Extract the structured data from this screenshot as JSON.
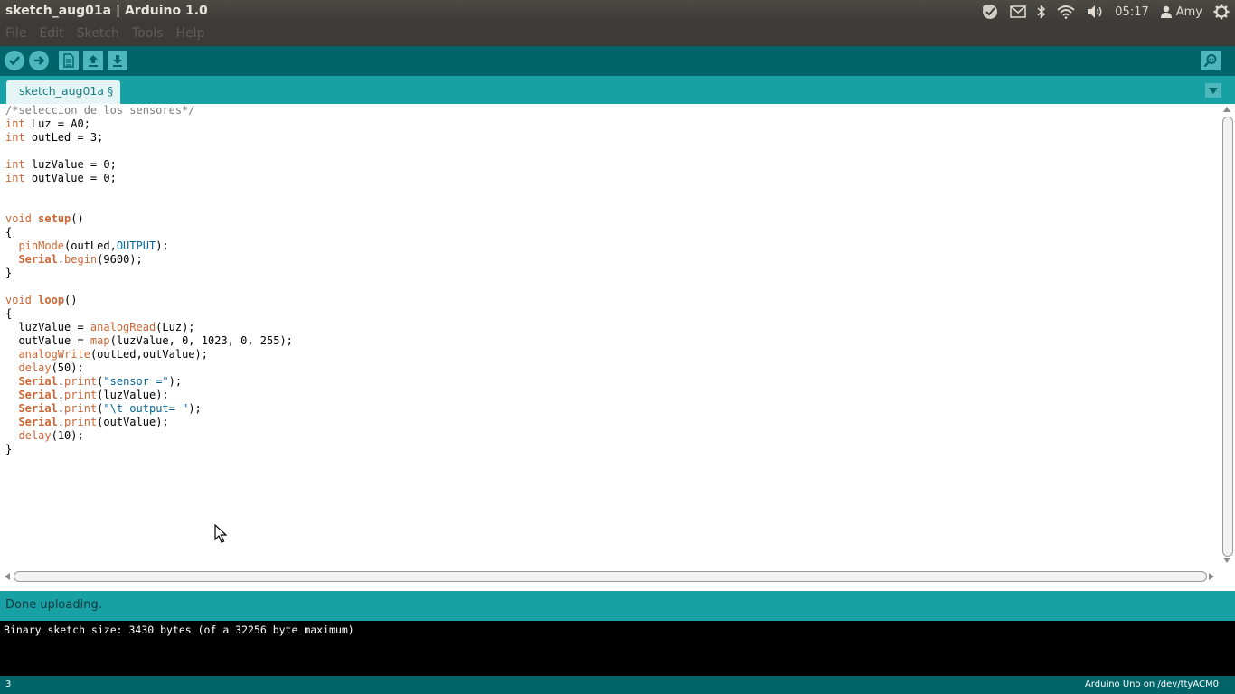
{
  "window": {
    "title_sketch": "sketch_aug01a",
    "title_separator": " | ",
    "title_app": "Arduino 1.0"
  },
  "tray": {
    "time": "05:17",
    "user": "Amy",
    "icons": [
      "check-bubble-icon",
      "mail-icon",
      "bluetooth-icon",
      "wifi-icon",
      "volume-icon",
      "user-icon",
      "power-gear-icon"
    ]
  },
  "menu": {
    "items": [
      "File",
      "Edit",
      "Sketch",
      "Tools",
      "Help"
    ]
  },
  "toolbar": {
    "buttons": [
      "verify-icon",
      "upload-icon",
      "new-icon",
      "open-icon",
      "save-icon"
    ],
    "serial_monitor": "serial-monitor-icon"
  },
  "tab": {
    "label": "sketch_aug01a §"
  },
  "editor": {
    "lines": [
      "/*seleccion de los sensores*/",
      "int Luz = A0;",
      "int outLed = 3;",
      "",
      "int luzValue = 0;",
      "int outValue = 0;",
      "",
      "",
      "void setup()",
      "{",
      "  pinMode(outLed,OUTPUT);",
      "  Serial.begin(9600);",
      "}",
      "",
      "void loop()",
      "{",
      "  luzValue = analogRead(Luz);",
      "  outValue = map(luzValue, 0, 1023, 0, 255);",
      "  analogWrite(outLed,outValue);",
      "  delay(50);",
      "  Serial.print(\"sensor =\");",
      "  Serial.print(luzValue);",
      "  Serial.print(\"\\t output= \");",
      "  Serial.print(outValue);",
      "  delay(10);",
      "}"
    ]
  },
  "status": {
    "message": "Done uploading."
  },
  "console": {
    "text": "Binary sketch size: 3430 bytes (of a 32256 byte maximum)"
  },
  "footer": {
    "line_number": "3",
    "board": "Arduino Uno on /dev/ttyACM0"
  },
  "colors": {
    "toolbar": "#006468",
    "tabbar": "#17a1a5",
    "keyword": "#cc6633",
    "constant": "#006699",
    "comment": "#7e7e7e"
  }
}
